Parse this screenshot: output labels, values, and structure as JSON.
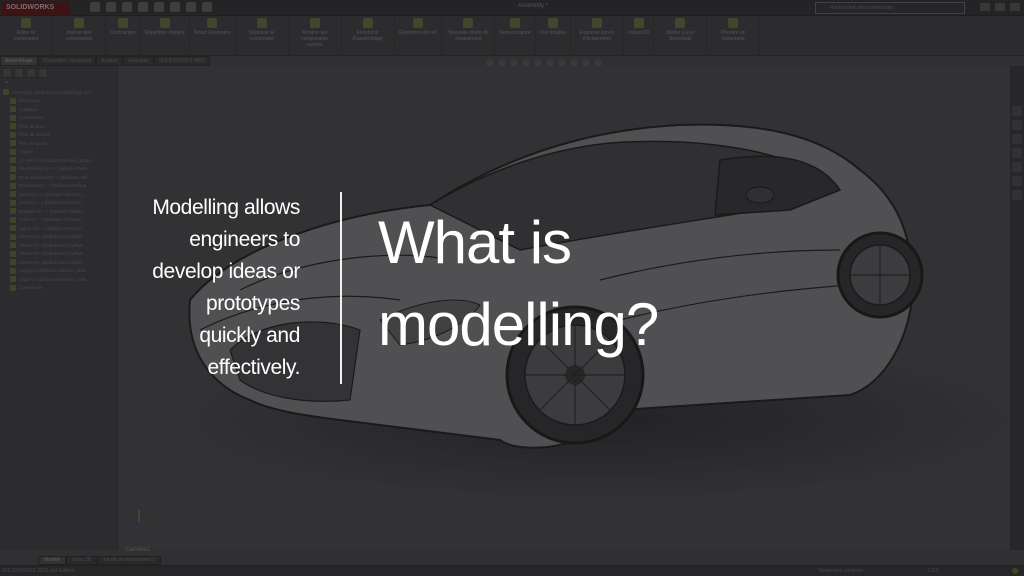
{
  "app": {
    "logo": "SOLIDWORKS",
    "document_title": "Assembly *",
    "search_placeholder": "Rechercher des commandes",
    "quick_access_icons": [
      "new-icon",
      "open-icon",
      "save-icon",
      "print-icon",
      "undo-icon",
      "select-icon",
      "rebuild-icon",
      "options-icon"
    ]
  },
  "ribbon": {
    "buttons": [
      {
        "label": "Editer le composant",
        "icon": "edit-component-icon"
      },
      {
        "label": "Insérer des composants",
        "icon": "insert-components-icon"
      },
      {
        "label": "Contraintes",
        "icon": "mate-icon"
      },
      {
        "label": "Répétition linéaire",
        "icon": "linear-pattern-icon"
      },
      {
        "label": "Smart Fasteners",
        "icon": "fasteners-icon"
      },
      {
        "label": "Déplacer le composant",
        "icon": "move-component-icon"
      },
      {
        "label": "Montrer les composants cachés",
        "icon": "show-hidden-icon"
      },
      {
        "label": "Fonctions d'assemblage",
        "icon": "assembly-features-icon"
      },
      {
        "label": "Géométrie de réf.",
        "icon": "reference-geometry-icon"
      },
      {
        "label": "Nouvelle étude de mouvement",
        "icon": "motion-study-icon"
      },
      {
        "label": "Nomenclature",
        "icon": "bom-icon"
      },
      {
        "label": "Vue éclatée",
        "icon": "exploded-view-icon"
      },
      {
        "label": "Esquisse lignes d'éclatement",
        "icon": "explode-line-icon"
      },
      {
        "label": "Instant3D",
        "icon": "instant3d-icon"
      },
      {
        "label": "Mettre à jour Speedpak",
        "icon": "speedpak-icon"
      },
      {
        "label": "Prendre un instantané",
        "icon": "snapshot-icon"
      }
    ]
  },
  "command_tabs": [
    {
      "label": "Assemblage",
      "active": true
    },
    {
      "label": "Disposition / Esquisse",
      "active": false
    },
    {
      "label": "Evaluer",
      "active": false
    },
    {
      "label": "Esquisse",
      "active": false
    },
    {
      "label": "SOLIDWORKS MBD",
      "active": false
    }
  ],
  "feature_tree": {
    "filter_label": "▼",
    "root": "Assembly (Défaut<Etat d'affichage-1>)",
    "items": [
      "Historique",
      "Capteurs",
      "Annotations",
      "Plan de face",
      "Plan de dessus",
      "Plan de droite",
      "Origine",
      "(-) AM<1> (Défaut<<Défaut>_Etat d",
      "WindShield<1> -> (Défaut<<Défa",
      "Rear Window<1> -> (Défaut<<Dé",
      "Windows<1> -> (Défaut<<Défaut",
      "Seats<1> -> (Défaut<<Défaut>_",
      "Hood<1> -> (Défaut<<Défaut>_",
      "Bumper<1> -> (Défaut<<Défaut",
      "Grille<1> -> (Défaut<<Défaut>_",
      "Lights<1> -> (Défaut<<Défaut>_",
      "Wheel<1> (Défaut<Etat d'affich",
      "Wheel<2> (Défaut<Etat d'affich",
      "Wheel<3> (Défaut<Etat d'affich",
      "Wheel<4> (Défaut<Etat d'affich",
      "Logo<1> (Défaut<<Défaut>_Etat",
      "Logo<2> (Défaut<<Défaut>_Etat",
      "Contraintes"
    ]
  },
  "viewport": {
    "camera_label": "Caméra1"
  },
  "bottom_tabs": [
    {
      "label": "Modèle",
      "active": true
    },
    {
      "label": "Vues 3D",
      "active": false
    },
    {
      "label": "Etude de mouvement 1",
      "active": false
    }
  ],
  "status_bar": {
    "product": "SOLIDWORKS 2015 x64 Edition",
    "state": "Totalement contraint",
    "units": "CGS"
  },
  "slide": {
    "subtitle_lines": [
      "Modelling allows",
      "engineers to",
      "develop ideas or",
      "prototypes",
      "quickly and",
      "effectively."
    ],
    "title_lines": [
      "What is",
      "modelling?"
    ]
  }
}
